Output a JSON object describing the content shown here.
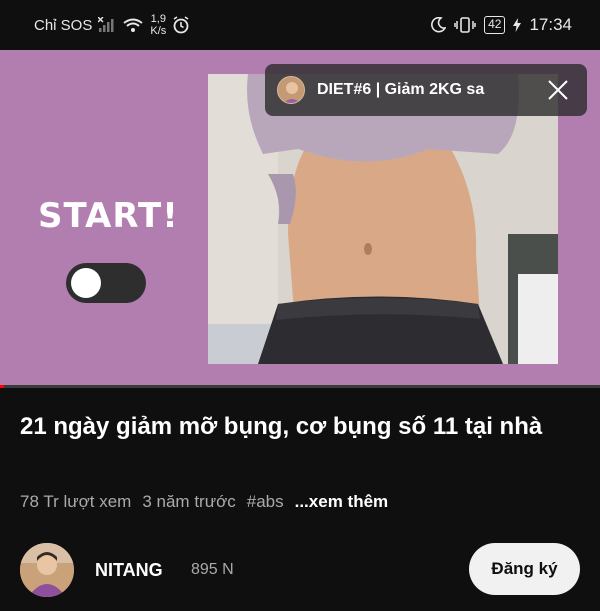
{
  "status_bar": {
    "carrier": "Chỉ SOS",
    "speed_value": "1,9",
    "speed_unit": "K/s",
    "battery": "42",
    "time": "17:34",
    "icons": [
      "signal-icon",
      "wifi-icon",
      "alarm-icon",
      "moon-icon",
      "vibrate-icon",
      "battery-icon",
      "charging-icon"
    ]
  },
  "video": {
    "background_color": "#b27eb0",
    "overlay_text": "START!",
    "progress_fraction": 0.007,
    "mini_player": {
      "title": "DIET#6 | Giảm 2KG sa"
    }
  },
  "info": {
    "title": "21 ngày giảm mỡ bụng, cơ bụng số 11 tại nhà",
    "views": "78 Tr lượt xem",
    "age": "3 năm trước",
    "hashtag": "#abs",
    "more": "...xem thêm"
  },
  "channel": {
    "name": "NITANG",
    "subscribers": "895 N",
    "subscribe_label": "Đăng ký"
  }
}
